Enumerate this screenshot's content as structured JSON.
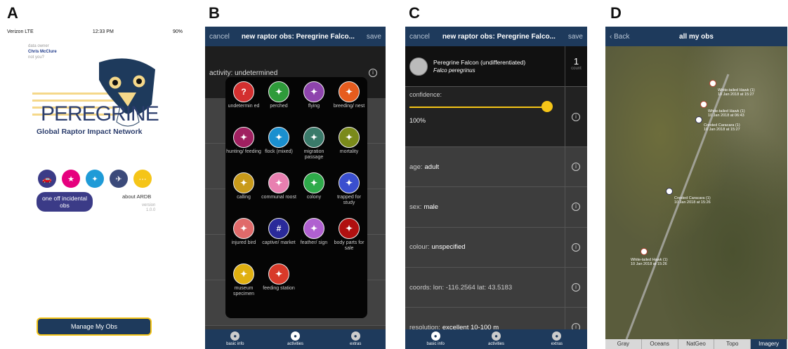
{
  "labels": {
    "a": "A",
    "b": "B",
    "c": "C",
    "d": "D"
  },
  "panelA": {
    "status": {
      "carrier": "Verizon  LTE",
      "time": "12:33 PM",
      "battery": "90%"
    },
    "owner_label": "data owner",
    "owner_name": "Chris McClure",
    "not_you": "not you?",
    "logo_word": "PEREGRINE",
    "network": "Global Raptor Impact Network",
    "incidental": "one off incidental obs",
    "about": "about ARDB",
    "version_label": "version",
    "version": "1.0.0",
    "manage": "Manage My Obs",
    "circle_colors": [
      "#3b3b87",
      "#e6007e",
      "#1f9bd7",
      "#3b4a7a",
      "#f5c518"
    ]
  },
  "panelB": {
    "nav": {
      "cancel": "cancel",
      "title": "new raptor obs: Peregrine Falco...",
      "save": "save"
    },
    "activity_label": "activity:",
    "activity_value": "undetermined",
    "icons": [
      {
        "label": "undetermin ed",
        "color": "#d32f2f",
        "glyph": "?"
      },
      {
        "label": "perched",
        "color": "#2e9b3a",
        "glyph": "✦"
      },
      {
        "label": "flying",
        "color": "#8e44ad",
        "glyph": "✦"
      },
      {
        "label": "breeding/ nest",
        "color": "#e65c1e",
        "glyph": "✦"
      },
      {
        "label": "hunting/ feeding",
        "color": "#a02060",
        "glyph": "✦"
      },
      {
        "label": "flock (mixed)",
        "color": "#1a8fcf",
        "glyph": "✦"
      },
      {
        "label": "migration passage",
        "color": "#3a7a6a",
        "glyph": "✦"
      },
      {
        "label": "mortality",
        "color": "#7a8a1a",
        "glyph": "✦"
      },
      {
        "label": "calling",
        "color": "#c89a1a",
        "glyph": "✦"
      },
      {
        "label": "communal roost",
        "color": "#e87fb0",
        "glyph": "✦"
      },
      {
        "label": "colony",
        "color": "#2eaa4a",
        "glyph": "✦"
      },
      {
        "label": "trapped for study",
        "color": "#3a4fcf",
        "glyph": "✦"
      },
      {
        "label": "injured bird",
        "color": "#e06a6a",
        "glyph": "✦"
      },
      {
        "label": "captive/ market",
        "color": "#2a2a9a",
        "glyph": "#"
      },
      {
        "label": "feather/ sign",
        "color": "#b060d0",
        "glyph": "✦"
      },
      {
        "label": "body parts for sale",
        "color": "#b01010",
        "glyph": "✦"
      },
      {
        "label": "museum specimen",
        "color": "#e0b010",
        "glyph": "✦"
      },
      {
        "label": "feeding station",
        "color": "#d83a2a",
        "glyph": "✦"
      }
    ],
    "tabs": [
      "basic info",
      "activities",
      "extras"
    ]
  },
  "panelC": {
    "nav": {
      "cancel": "cancel",
      "title": "new raptor obs: Peregrine Falco...",
      "save": "save"
    },
    "species_common": "Peregrine Falcon (undifferentiated)",
    "species_latin": "Falco peregrinus",
    "count": "1",
    "count_label": "count",
    "confidence_label": "confidence:",
    "confidence_value": "100%",
    "confidence_level": 1.0,
    "fields": [
      {
        "label": "age:",
        "value": "adult"
      },
      {
        "label": "sex:",
        "value": "male"
      },
      {
        "label": "colour:",
        "value": "unspecified"
      },
      {
        "label": "coords: lon: -116.2564  lat: 43.5183",
        "value": ""
      },
      {
        "label": "resolution:",
        "value": "excellent 10-100 m"
      }
    ],
    "tabs": [
      "basic info",
      "activities",
      "extras"
    ]
  },
  "panelD": {
    "back": "Back",
    "title": "all my obs",
    "pins": [
      {
        "species": "White-tailed Hawk (1)",
        "date": "10 Jan 2018 at 15:27"
      },
      {
        "species": "White-tailed Hawk (1)",
        "date": "10 Jan 2018 at 06:43"
      },
      {
        "species": "Crested Caracara (1)",
        "date": "10 Jan 2018 at 15:27"
      },
      {
        "species": "Crested Caracara (1)",
        "date": "10 Jan 2018 at 15:26"
      },
      {
        "species": "White-tailed Hawk (1)",
        "date": "10 Jan 2018 at 15:26"
      }
    ],
    "map_tabs": [
      "Gray",
      "Oceans",
      "NatGeo",
      "Topo",
      "Imagery"
    ]
  }
}
